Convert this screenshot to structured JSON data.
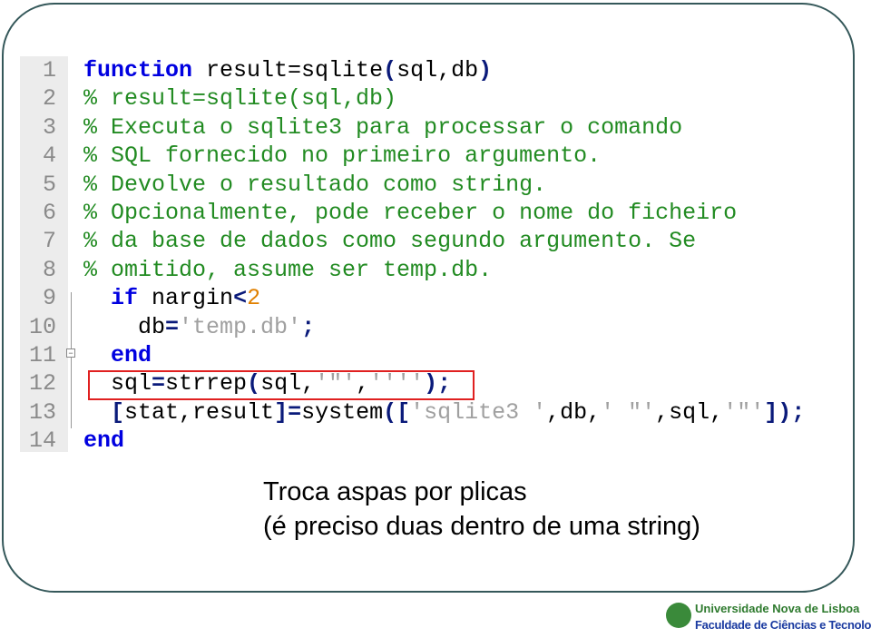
{
  "code": {
    "lines": [
      {
        "num": "1",
        "tokens": [
          {
            "t": "function",
            "c": "kw"
          },
          {
            "t": " result=sqlite",
            "c": "tx"
          },
          {
            "t": "(",
            "c": "br"
          },
          {
            "t": "sql,db",
            "c": "tx"
          },
          {
            "t": ")",
            "c": "br"
          }
        ]
      },
      {
        "num": "2",
        "tokens": [
          {
            "t": "% result=sqlite(sql,db)",
            "c": "cm"
          }
        ]
      },
      {
        "num": "3",
        "tokens": [
          {
            "t": "% Executa o sqlite3 para processar o comando",
            "c": "cm"
          }
        ]
      },
      {
        "num": "4",
        "tokens": [
          {
            "t": "% SQL fornecido no primeiro argumento.",
            "c": "cm"
          }
        ]
      },
      {
        "num": "5",
        "tokens": [
          {
            "t": "% Devolve o resultado como string.",
            "c": "cm"
          }
        ]
      },
      {
        "num": "6",
        "tokens": [
          {
            "t": "% Opcionalmente, pode receber o nome do ficheiro",
            "c": "cm"
          }
        ]
      },
      {
        "num": "7",
        "tokens": [
          {
            "t": "% da base de dados como segundo argumento. Se",
            "c": "cm"
          }
        ]
      },
      {
        "num": "8",
        "tokens": [
          {
            "t": "% omitido, assume ser temp.db.",
            "c": "cm"
          }
        ]
      },
      {
        "num": "9",
        "tokens": [
          {
            "t": "  ",
            "c": "tx"
          },
          {
            "t": "if",
            "c": "kw"
          },
          {
            "t": " nargin",
            "c": "tx"
          },
          {
            "t": "<",
            "c": "br"
          },
          {
            "t": "2",
            "c": "nm"
          }
        ]
      },
      {
        "num": "10",
        "tokens": [
          {
            "t": "    db",
            "c": "tx"
          },
          {
            "t": "=",
            "c": "br"
          },
          {
            "t": "'temp.db'",
            "c": "st"
          },
          {
            "t": ";",
            "c": "br"
          }
        ]
      },
      {
        "num": "11",
        "tokens": [
          {
            "t": "  ",
            "c": "tx"
          },
          {
            "t": "end",
            "c": "kw"
          }
        ]
      },
      {
        "num": "12",
        "tokens": [
          {
            "t": "  sql",
            "c": "tx"
          },
          {
            "t": "=",
            "c": "br"
          },
          {
            "t": "strrep",
            "c": "tx"
          },
          {
            "t": "(",
            "c": "br"
          },
          {
            "t": "sql,",
            "c": "tx"
          },
          {
            "t": "'\"'",
            "c": "st"
          },
          {
            "t": ",",
            "c": "tx"
          },
          {
            "t": "''''",
            "c": "st"
          },
          {
            "t": ");",
            "c": "br"
          }
        ]
      },
      {
        "num": "13",
        "tokens": [
          {
            "t": "  ",
            "c": "tx"
          },
          {
            "t": "[",
            "c": "br"
          },
          {
            "t": "stat,result",
            "c": "tx"
          },
          {
            "t": "]=",
            "c": "br"
          },
          {
            "t": "system",
            "c": "tx"
          },
          {
            "t": "([",
            "c": "br"
          },
          {
            "t": "'sqlite3 '",
            "c": "st"
          },
          {
            "t": ",db,",
            "c": "tx"
          },
          {
            "t": "' \"'",
            "c": "st"
          },
          {
            "t": ",sql,",
            "c": "tx"
          },
          {
            "t": "'\"'",
            "c": "st"
          },
          {
            "t": "]);",
            "c": "br"
          }
        ]
      },
      {
        "num": "14",
        "tokens": [
          {
            "t": "end",
            "c": "kw"
          }
        ]
      }
    ],
    "highlighted_line": "12"
  },
  "caption": {
    "line1": "Troca aspas por plicas",
    "line2": "(é preciso duas dentro de uma string)"
  },
  "logo": {
    "mark": "UN",
    "line1": "Universidade Nova de Lisboa",
    "line2": "Faculdade de Ciências e Tecnologia"
  },
  "colors": {
    "keyword": "#0000e0",
    "comment": "#228b22",
    "string": "#a0a0a0",
    "number": "#e08000",
    "highlight_box": "#e02020",
    "frame": "#35585a"
  }
}
